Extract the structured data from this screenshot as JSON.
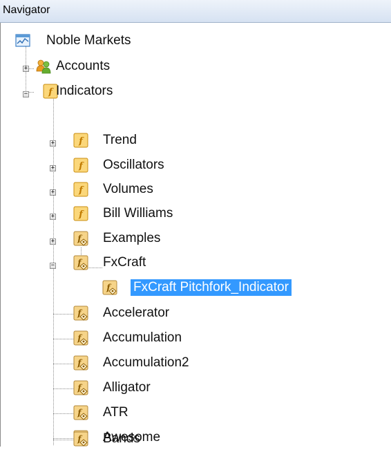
{
  "window": {
    "title": "Navigator"
  },
  "tree": {
    "root": {
      "label": "Noble Markets",
      "icon": "terminal-icon"
    },
    "accounts": {
      "label": "Accounts",
      "icon": "accounts-icon",
      "state": "collapsed"
    },
    "indicators": {
      "label": "Indicators",
      "icon": "folder-indicator-icon",
      "state": "expanded",
      "folders": [
        {
          "label": "Trend",
          "icon": "folder-indicator-icon",
          "state": "collapsed"
        },
        {
          "label": "Oscillators",
          "icon": "folder-indicator-icon",
          "state": "collapsed"
        },
        {
          "label": "Volumes",
          "icon": "folder-indicator-icon",
          "state": "collapsed"
        },
        {
          "label": "Bill Williams",
          "icon": "folder-indicator-icon",
          "state": "collapsed"
        },
        {
          "label": "Examples",
          "icon": "custom-indicator-icon",
          "state": "collapsed"
        },
        {
          "label": "FxCraft",
          "icon": "custom-indicator-icon",
          "state": "expanded"
        }
      ],
      "fxcraft_children": [
        {
          "label": "FxCraft Pitchfork_Indicator",
          "icon": "custom-indicator-icon",
          "selected": true
        }
      ],
      "items": [
        {
          "label": "Accelerator",
          "icon": "custom-indicator-icon"
        },
        {
          "label": "Accumulation",
          "icon": "custom-indicator-icon"
        },
        {
          "label": "Accumulation2",
          "icon": "custom-indicator-icon"
        },
        {
          "label": "Alligator",
          "icon": "custom-indicator-icon"
        },
        {
          "label": "ATR",
          "icon": "custom-indicator-icon"
        },
        {
          "label": "Awesome",
          "icon": "custom-indicator-icon"
        },
        {
          "label": "Bands",
          "icon": "custom-indicator-icon"
        }
      ]
    }
  },
  "colors": {
    "selection": "#3399ff",
    "titlebar": "#d6e2f2"
  }
}
